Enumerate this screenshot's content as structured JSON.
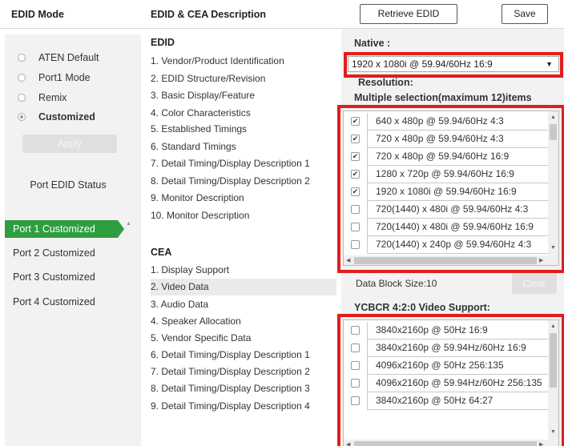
{
  "header": {
    "edid_mode_title": "EDID Mode",
    "description_title": "EDID & CEA Description",
    "retrieve_label": "Retrieve EDID",
    "save_label": "Save"
  },
  "modes": [
    {
      "label": "ATEN Default",
      "checked": false
    },
    {
      "label": "Port1 Mode",
      "checked": false
    },
    {
      "label": "Remix",
      "checked": false
    },
    {
      "label": "Customized",
      "checked": true
    }
  ],
  "apply_label": "Apply",
  "port_status_title": "Port EDID Status",
  "ports": [
    {
      "label": "Port 1  Customized",
      "active": true
    },
    {
      "label": "Port 2  Customized",
      "active": false
    },
    {
      "label": "Port 3  Customized",
      "active": false
    },
    {
      "label": "Port 4  Customized",
      "active": false
    }
  ],
  "edid": {
    "title": "EDID",
    "items": [
      "1.  Vendor/Product Identification",
      "2.  EDID Structure/Revision",
      "3.  Basic Display/Feature",
      "4.  Color Characteristics",
      "5.  Established Timings",
      "6.  Standard Timings",
      "7.  Detail Timing/Display Description 1",
      "8.  Detail Timing/Display Description 2",
      "9.  Monitor Description",
      "10.  Monitor Description"
    ]
  },
  "cea": {
    "title": "CEA",
    "items": [
      "1.  Display Support",
      "2.  Video Data",
      "3.  Audio Data",
      "4.  Speaker Allocation",
      "5.  Vendor Specific Data",
      "6.  Detail Timing/Display Description 1",
      "7.  Detail Timing/Display Description 2",
      "8.  Detail Timing/Display Description 3",
      "9.  Detail Timing/Display Description 4"
    ],
    "selected_index": 1
  },
  "native": {
    "label": "Native :",
    "value": "1920 x 1080i @ 59.94/60Hz 16:9"
  },
  "resolution": {
    "label": "Resolution:",
    "hint": "Multiple selection(maximum 12)items",
    "items": [
      {
        "label": "640 x 480p @ 59.94/60Hz 4:3",
        "checked": true
      },
      {
        "label": "720 x 480p @ 59.94/60Hz 4:3",
        "checked": true
      },
      {
        "label": "720 x 480p @ 59.94/60Hz 16:9",
        "checked": true
      },
      {
        "label": "1280 x 720p @ 59.94/60Hz 16:9",
        "checked": true
      },
      {
        "label": "1920 x 1080i @ 59.94/60Hz 16:9",
        "checked": true
      },
      {
        "label": "720(1440) x 480i @ 59.94/60Hz 4:3",
        "checked": false
      },
      {
        "label": "720(1440) x 480i @ 59.94/60Hz 16:9",
        "checked": false
      },
      {
        "label": "720(1440) x 240p @ 59.94/60Hz 4:3",
        "checked": false
      }
    ]
  },
  "data_block_size": "Data Block Size:10",
  "clear_label": "Clear",
  "ycbcr": {
    "label": "YCBCR 4:2:0 Video Support:",
    "items": [
      {
        "label": "3840x2160p @ 50Hz 16:9",
        "checked": false
      },
      {
        "label": "3840x2160p @ 59.94Hz/60Hz 16:9",
        "checked": false
      },
      {
        "label": "4096x2160p @ 50Hz 256:135",
        "checked": false
      },
      {
        "label": "4096x2160p @ 59.94Hz/60Hz 256:135",
        "checked": false
      },
      {
        "label": "3840x2160p @ 50Hz 64:27",
        "checked": false
      }
    ]
  },
  "colors": {
    "accent_green": "#2e9e3e",
    "highlight_red": "#e01e1e"
  }
}
